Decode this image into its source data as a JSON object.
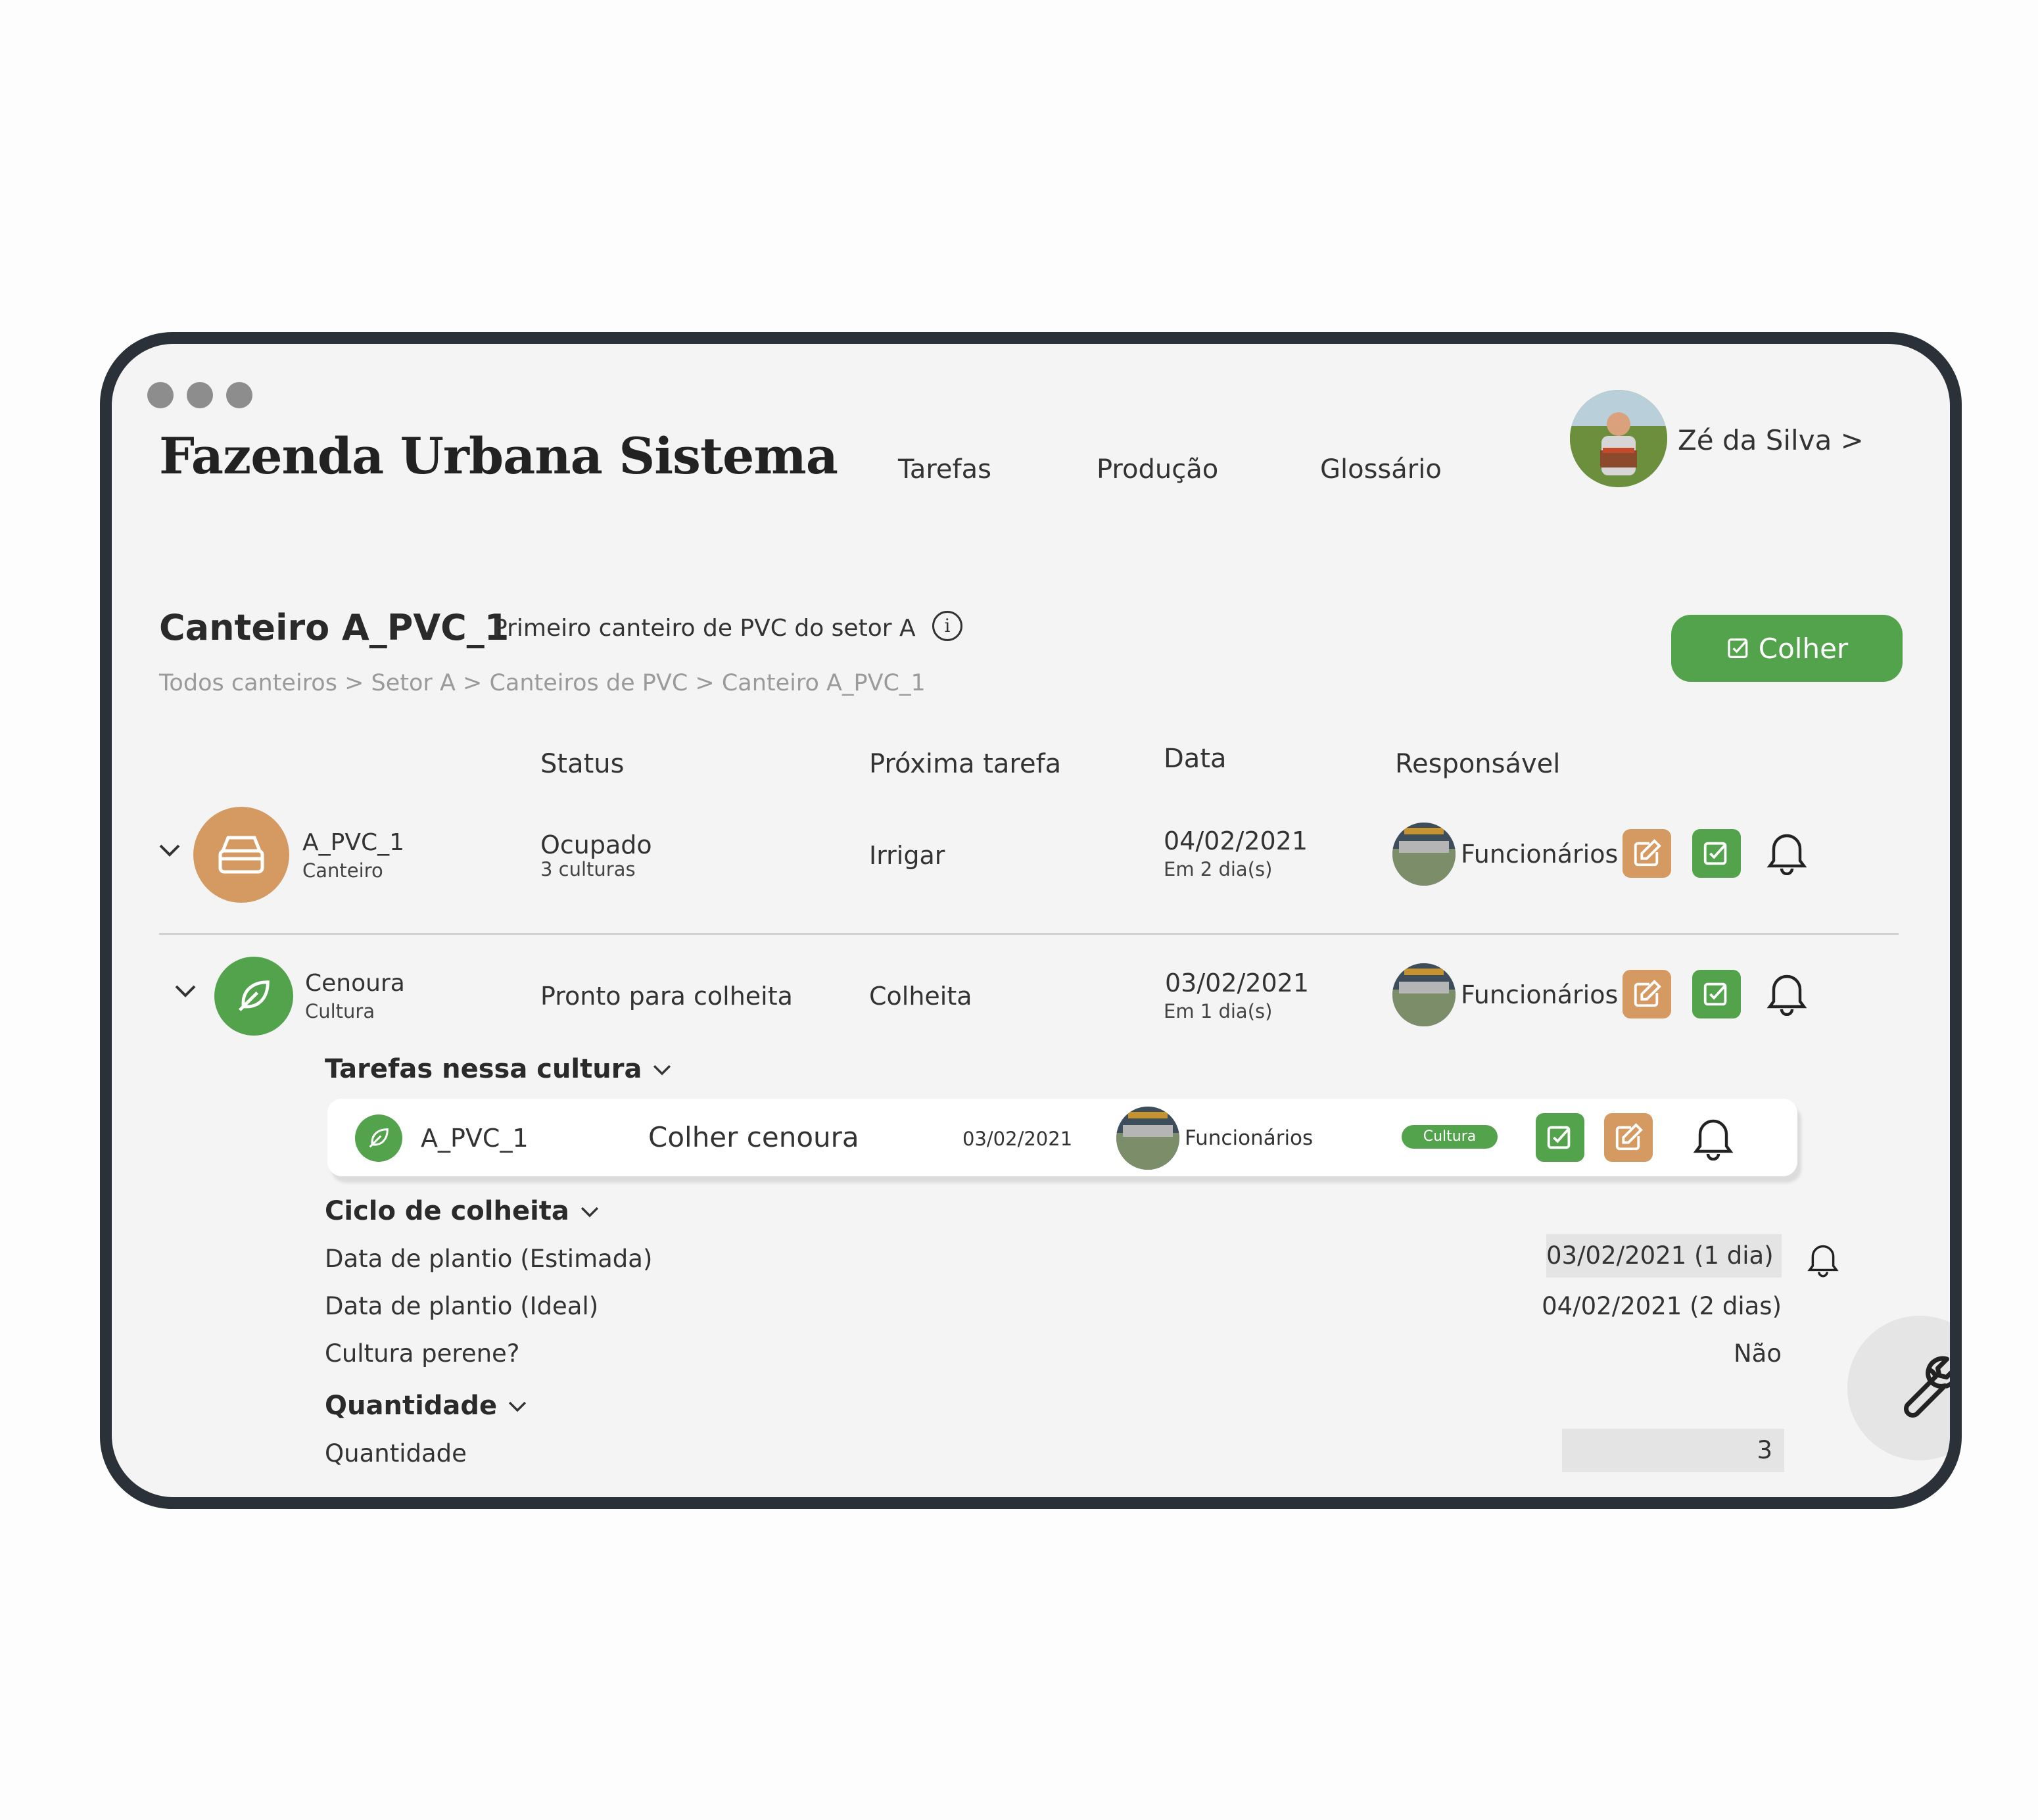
{
  "app": {
    "title": "Fazenda Urbana Sistema"
  },
  "nav": {
    "items": [
      "Tarefas",
      "Produção",
      "Glossário"
    ]
  },
  "user": {
    "name": "Zé da Silva >"
  },
  "page": {
    "title": "Canteiro A_PVC_1",
    "subtitle": "Primeiro canteiro de PVC do setor A",
    "breadcrumb": "Todos canteiros > Setor A > Canteiros de PVC > Canteiro A_PVC_1",
    "action_label": "Colher"
  },
  "columns": {
    "status": "Status",
    "next_task": "Próxima tarefa",
    "date": "Data",
    "responsible": "Responsável"
  },
  "rows": [
    {
      "name": "A_PVC_1",
      "type": "Canteiro",
      "status": "Ocupado",
      "status_sub": "3 culturas",
      "next_task": "Irrigar",
      "date": "04/02/2021",
      "date_sub": "Em 2 dia(s)",
      "responsible": "Funcionários",
      "color": "#d49a62"
    },
    {
      "name": "Cenoura",
      "type": "Cultura",
      "status": "Pronto para colheita",
      "status_sub": "",
      "next_task": "Colheita",
      "date": "03/02/2021",
      "date_sub": "Em 1 dia(s)",
      "responsible": "Funcionários",
      "color": "#52a34c"
    }
  ],
  "tasks_section": {
    "title": "Tarefas nessa cultura",
    "task": {
      "location": "A_PVC_1",
      "title": "Colher cenoura",
      "date": "03/02/2021",
      "responsible": "Funcionários",
      "tag": "Cultura"
    }
  },
  "cycle_section": {
    "title": "Ciclo de colheita",
    "fields": [
      {
        "label": "Data de plantio (Estimada)",
        "value": "03/02/2021 (1 dia)"
      },
      {
        "label": "Data de plantio (Ideal)",
        "value": "04/02/2021 (2 dias)"
      },
      {
        "label": "Cultura perene?",
        "value": "Não"
      }
    ]
  },
  "quantity_section": {
    "title": "Quantidade",
    "fields": [
      {
        "label": "Quantidade",
        "value": "3"
      }
    ]
  },
  "colors": {
    "accent_green": "#52a34c",
    "accent_orange": "#d49a62",
    "frame": "#2b3138"
  },
  "icons": [
    "chevron-down-icon",
    "archive-box-icon",
    "leaf-icon",
    "edit-icon",
    "check-square-icon",
    "bell-icon",
    "info-icon",
    "wrench-icon"
  ]
}
